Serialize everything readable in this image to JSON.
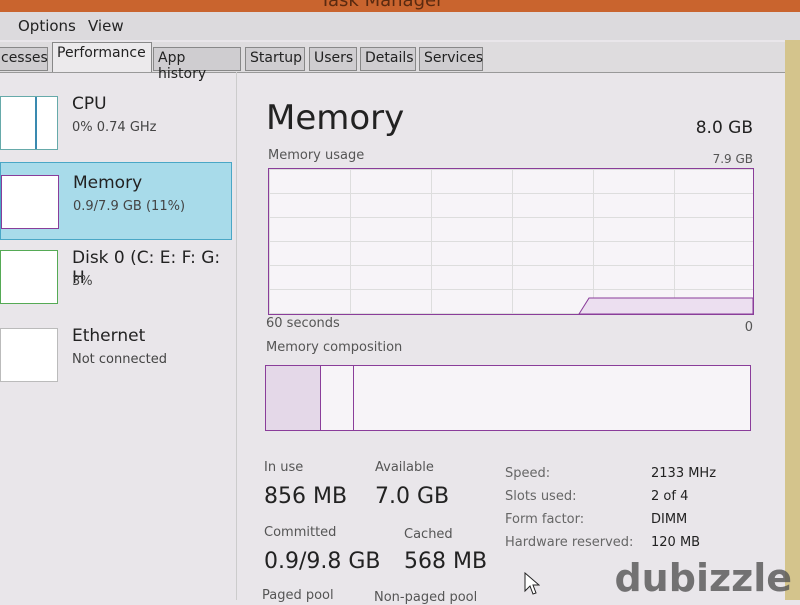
{
  "window": {
    "title": "Task Manager"
  },
  "menu": [
    "Options",
    "View"
  ],
  "tabs": [
    "cesses",
    "Performance",
    "App history",
    "Startup",
    "Users",
    "Details",
    "Services"
  ],
  "sidebar": [
    {
      "name": "CPU",
      "sub": "0% 0.74 GHz"
    },
    {
      "name": "Memory",
      "sub": "0.9/7.9 GB (11%)",
      "selected": true
    },
    {
      "name": "Disk 0 (C: E: F: G: H",
      "sub": "3%"
    },
    {
      "name": "Ethernet",
      "sub": "Not connected"
    }
  ],
  "memory": {
    "title": "Memory",
    "total": "8.0 GB",
    "usage_label": "Memory usage",
    "usage_max": "7.9 GB",
    "time_left": "60 seconds",
    "time_right": "0",
    "composition_label": "Memory composition",
    "in_use_label": "In use",
    "in_use": "856 MB",
    "available_label": "Available",
    "available": "7.0 GB",
    "committed_label": "Committed",
    "committed": "0.9/9.8 GB",
    "cached_label": "Cached",
    "cached": "568 MB",
    "paged_label": "Paged pool",
    "nonpaged_label": "Non-paged pool",
    "usage_percent": 11,
    "details": [
      {
        "k": "Speed:",
        "v": "2133 MHz"
      },
      {
        "k": "Slots used:",
        "v": "2 of 4"
      },
      {
        "k": "Form factor:",
        "v": "DIMM"
      },
      {
        "k": "Hardware reserved:",
        "v": "120 MB"
      }
    ]
  },
  "watermark": "dubizzle",
  "colors": {
    "accent": "#8a3d9a",
    "selection": "#a8dbea"
  }
}
